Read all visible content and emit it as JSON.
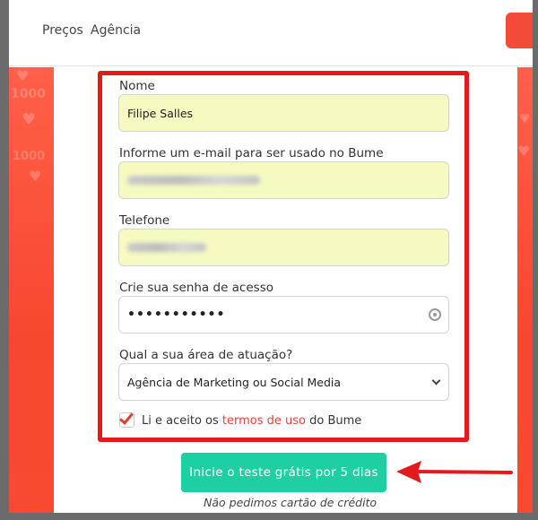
{
  "nav": {
    "links": [
      "Preços",
      "Agência"
    ]
  },
  "form": {
    "name_label": "Nome",
    "name_value": "Filipe Salles",
    "email_label": "Informe um e-mail para ser usado no Bume",
    "phone_label": "Telefone",
    "password_label": "Crie sua senha de acesso",
    "password_value": "•••••••••••",
    "area_label": "Qual a sua área de atuação?",
    "area_selected": "Agência de Marketing ou Social Media",
    "terms_prefix": "Li e aceito os",
    "terms_link": "termos de uso",
    "terms_suffix": "do Bume",
    "terms_checked": true
  },
  "cta": {
    "button_label": "Inicie o teste grátis por 5 dias",
    "note": "Não pedimos cartão de crédito"
  },
  "colors": {
    "accent_red": "#f44a3a",
    "highlight_red": "#e4191c",
    "cta_green": "#1ecfa3",
    "input_fill": "#f6f9c0"
  }
}
